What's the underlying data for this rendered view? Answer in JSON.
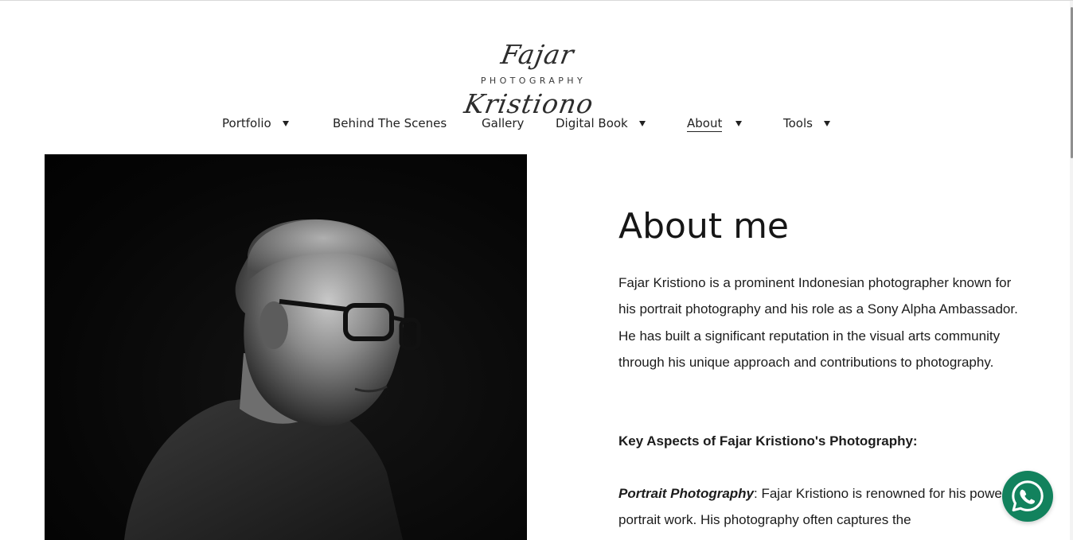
{
  "brand": {
    "script_name": "Fajar Kristiono",
    "subtitle": "PHOTOGRAPHY"
  },
  "nav": {
    "items": [
      {
        "label": "Portfolio",
        "dropdown": true
      },
      {
        "label": "Behind The Scenes",
        "dropdown": false
      },
      {
        "label": "Gallery",
        "dropdown": false
      },
      {
        "label": "Digital Book",
        "dropdown": true
      },
      {
        "label": "About",
        "dropdown": true,
        "active": true
      },
      {
        "label": "Tools",
        "dropdown": true
      }
    ]
  },
  "hero_image": {
    "icon": "portrait-photo",
    "tone": "black-and-white"
  },
  "about": {
    "title": "About me",
    "intro": "Fajar Kristiono is a prominent Indonesian photographer known for his portrait photography and his role as a Sony Alpha Ambassador. He has built a significant reputation in the visual arts community through his unique approach and contributions to photography.",
    "key_heading": "Key Aspects of Fajar Kristiono's Photography:",
    "aspect_1_title": "Portrait Photography",
    "aspect_1_text": ": Fajar Kristiono is renowned for his powerful portrait work. His photography often captures the"
  },
  "whatsapp": {
    "icon": "whatsapp-icon",
    "color": "#12825d"
  },
  "colors": {
    "text": "#161616",
    "background": "#ffffff"
  }
}
